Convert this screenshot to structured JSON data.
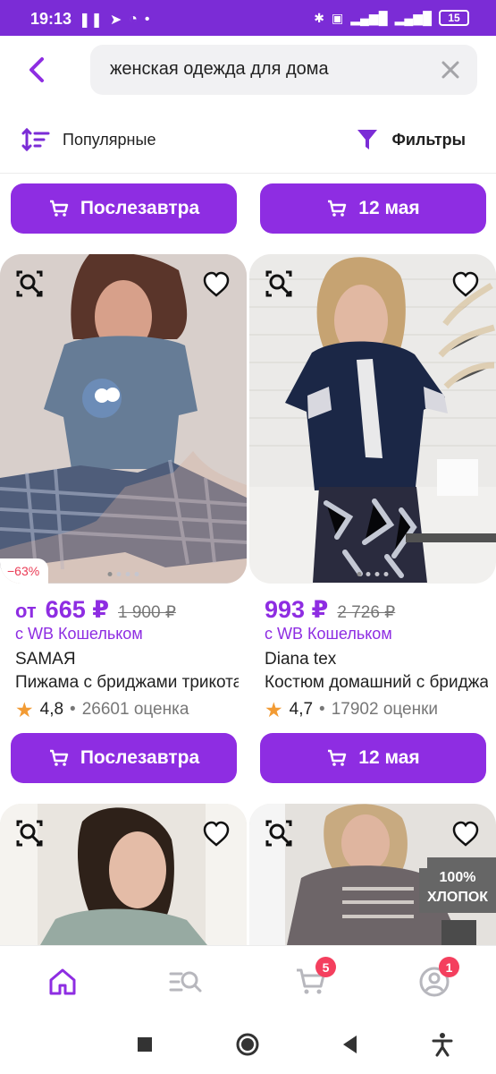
{
  "status_bar": {
    "time": "19:13",
    "left_icons": [
      "pause-icon",
      "telegram-icon",
      "shield-icon",
      "dot-icon"
    ],
    "right_icons": [
      "bluetooth-icon",
      "volte-icon",
      "signal-4g-icon",
      "signal-icon"
    ],
    "battery": "15"
  },
  "search": {
    "query": "женская одежда для дома"
  },
  "toolbar": {
    "sort_label": "Популярные",
    "filter_label": "Фильтры"
  },
  "colors": {
    "accent": "#8e2de2",
    "status_bar": "#7b2cd6",
    "discount": "#ea3b55",
    "star": "#f29b34",
    "badge": "#f43f5e"
  },
  "delivery_row_top": [
    {
      "label": "Послезавтра"
    },
    {
      "label": "12 мая"
    }
  ],
  "products": [
    {
      "discount": "−63%",
      "price_prefix": "от",
      "price": "665 ₽",
      "old_price": "1 900 ₽",
      "wallet": "с WB Кошельком",
      "brand": "SAMAЯ",
      "title": "Пижама с бриджами трикотажная",
      "rating": "4,8",
      "reviews": "26601 оценка",
      "delivery": "Послезавтра"
    },
    {
      "price": "993 ₽",
      "old_price": "2 726 ₽",
      "wallet": "с WB Кошельком",
      "brand": "Diana tex",
      "title": "Костюм домашний с бриджами",
      "rating": "4,7",
      "reviews": "17902 оценки",
      "delivery": "12 мая"
    }
  ],
  "bottom_row_badge": "100% ХЛОПОК",
  "bottom_nav": {
    "items": [
      {
        "name": "home-icon"
      },
      {
        "name": "catalog-icon"
      },
      {
        "name": "cart-icon",
        "badge": "5"
      },
      {
        "name": "profile-icon",
        "badge": "1"
      }
    ]
  }
}
